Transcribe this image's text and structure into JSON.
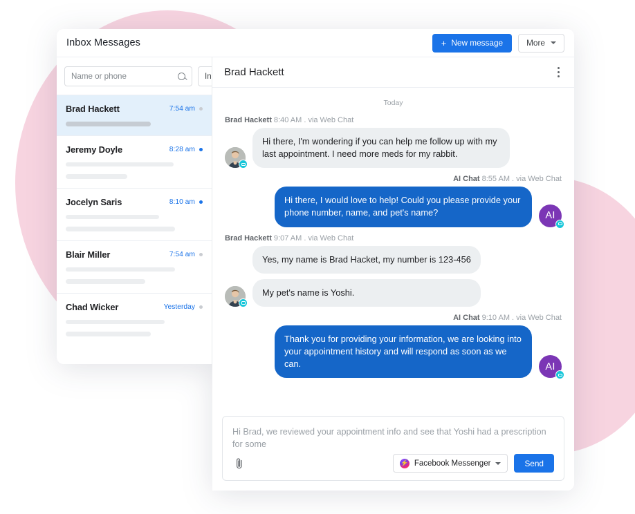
{
  "app": {
    "title": "Inbox Messages",
    "new_message_label": "New message",
    "more_label": "More",
    "plus_icon": "plus-icon"
  },
  "sidebar": {
    "search_placeholder": "Name or phone",
    "search_value": "",
    "folder_label": "Inbox",
    "conversations": [
      {
        "name": "Brad Hackett",
        "time": "7:54 am",
        "unread": false,
        "active": true,
        "lines": 1
      },
      {
        "name": "Jeremy Doyle",
        "time": "8:28 am",
        "unread": true,
        "active": false,
        "lines": 2
      },
      {
        "name": "Jocelyn Saris",
        "time": "8:10 am",
        "unread": true,
        "active": false,
        "lines": 2
      },
      {
        "name": "Blair Miller",
        "time": "7:54 am",
        "unread": false,
        "active": false,
        "lines": 2
      },
      {
        "name": "Chad Wicker",
        "time": "Yesterday",
        "unread": false,
        "active": false,
        "lines": 2
      }
    ]
  },
  "chat": {
    "title": "Brad Hackett",
    "menu_icon": "kebab-menu-icon",
    "day_divider": "Today",
    "messages": [
      {
        "direction": "in",
        "sender": "Brad Hackett",
        "meta": " 8:40 AM . via Web Chat",
        "avatar": "contact-avatar",
        "badge": "web-chat-badge",
        "texts": [
          "Hi there, I'm wondering if you can help me follow up with my last appointment. I need more meds for my rabbit."
        ]
      },
      {
        "direction": "out",
        "sender": "AI Chat",
        "meta": " 8:55 AM . via Web Chat",
        "avatar": "AI",
        "badge": "web-chat-badge",
        "texts": [
          "Hi there, I would love to help! Could you please provide your phone number, name, and pet's name?"
        ]
      },
      {
        "direction": "in",
        "sender": "Brad Hackett",
        "meta": " 9:07 AM . via Web Chat",
        "avatar": "contact-avatar",
        "badge": "web-chat-badge",
        "texts": [
          "Yes, my name is Brad Hacket, my number is 123-456",
          "My pet's name is Yoshi."
        ]
      },
      {
        "direction": "out",
        "sender": "AI Chat",
        "meta": " 9:10 AM . via Web Chat",
        "avatar": "AI",
        "badge": "web-chat-badge",
        "texts": [
          "Thank you for providing your information, we are looking into your appointment history and will respond as soon as we can."
        ]
      }
    ]
  },
  "composer": {
    "placeholder": "Hi Brad, we reviewed your appointment info and see that Yoshi had a prescription for some",
    "value": "",
    "attach_icon": "paperclip-icon",
    "channel_label": "Facebook Messenger",
    "channel_icon": "facebook-messenger-icon",
    "send_label": "Send"
  },
  "colors": {
    "accent_blue": "#1a73e8",
    "bubble_out": "#1566c8",
    "bubble_in": "#eceff1",
    "ai_purple": "#7b36b5",
    "badge_teal": "#16c6d9",
    "blob_pink": "#f7d4e0",
    "active_row": "#e3f0fb"
  }
}
